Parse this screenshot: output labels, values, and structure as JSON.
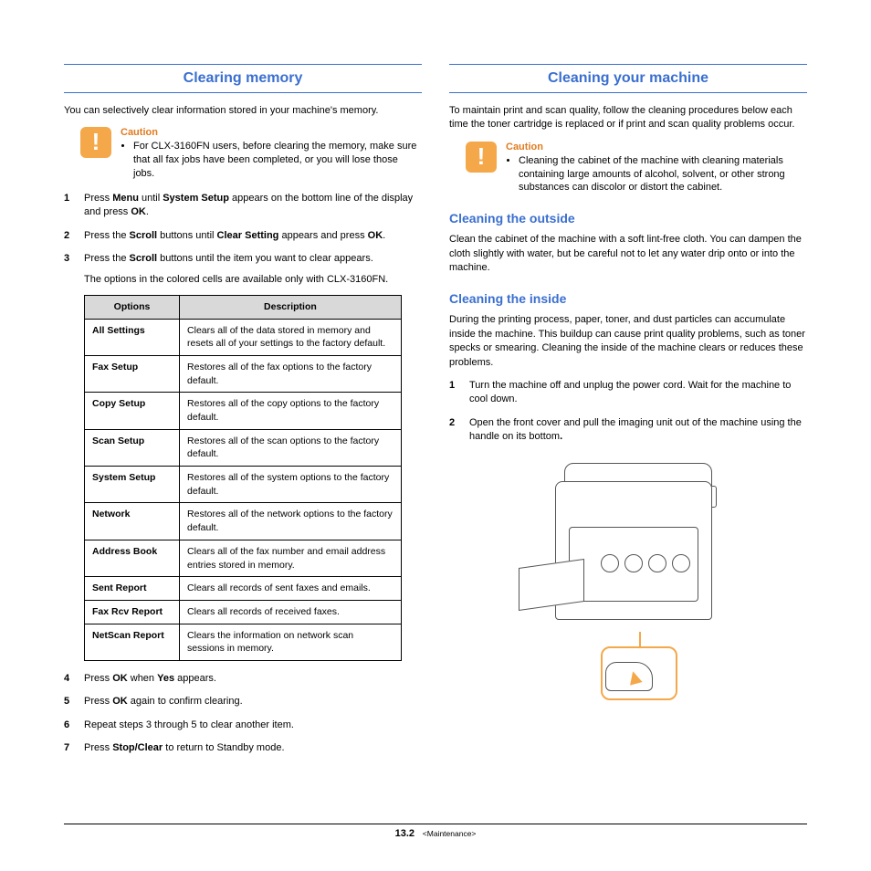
{
  "left": {
    "title": "Clearing memory",
    "intro": "You can selectively clear information stored in your machine's memory.",
    "caution": {
      "label": "Caution",
      "text": "For CLX-3160FN users, before clearing the memory, make sure that all fax jobs have been completed, or you will lose those jobs."
    },
    "step1_a": "Press ",
    "step1_b": "Menu",
    "step1_c": " until ",
    "step1_d": "System Setup",
    "step1_e": " appears on the bottom line of the display and press ",
    "step1_f": "OK",
    "step1_g": ".",
    "step2_a": "Press the ",
    "step2_b": "Scroll",
    "step2_c": " buttons until ",
    "step2_d": "Clear Setting",
    "step2_e": " appears and press ",
    "step2_f": "OK",
    "step2_g": ".",
    "step3_a": "Press the ",
    "step3_b": "Scroll",
    "step3_c": " buttons until the item you want to clear appears.",
    "note": "The options in the colored cells are available only with CLX-3160FN.",
    "table": {
      "h1": "Options",
      "h2": "Description",
      "rows": [
        {
          "o": "All Settings",
          "d": "Clears all of the data stored in memory and resets all of your settings to the factory default."
        },
        {
          "o": "Fax Setup",
          "d": "Restores all of the fax options to the factory default."
        },
        {
          "o": "Copy Setup",
          "d": "Restores all of the copy options to the factory default."
        },
        {
          "o": "Scan Setup",
          "d": "Restores all of the scan options to the factory default."
        },
        {
          "o": "System Setup",
          "d": "Restores all of the system options to the factory default."
        },
        {
          "o": "Network",
          "d": "Restores all of the network options to the factory default."
        },
        {
          "o": "Address Book",
          "d": "Clears all of the fax number and email address entries stored in memory."
        },
        {
          "o": "Sent Report",
          "d": "Clears all records of sent faxes and emails."
        },
        {
          "o": "Fax Rcv Report",
          "d": "Clears all records of received faxes."
        },
        {
          "o": "NetScan Report",
          "d": "Clears the information on network scan sessions in memory."
        }
      ]
    },
    "step4_a": "Press ",
    "step4_b": "OK",
    "step4_c": " when ",
    "step4_d": "Yes",
    "step4_e": " appears.",
    "step5_a": "Press ",
    "step5_b": "OK",
    "step5_c": " again to confirm clearing.",
    "step6": "Repeat steps 3 through 5 to clear another item.",
    "step7_a": "Press ",
    "step7_b": "Stop/Clear",
    "step7_c": " to return to Standby mode."
  },
  "right": {
    "title": "Cleaning your machine",
    "intro": "To maintain print and scan quality, follow the cleaning procedures below each time the toner cartridge is replaced or if print and scan quality problems occur.",
    "caution": {
      "label": "Caution",
      "text": "Cleaning the cabinet of the machine with cleaning materials containing large amounts of alcohol, solvent, or other strong substances can discolor or distort the cabinet."
    },
    "sub1": "Cleaning the outside",
    "p1": "Clean the cabinet of the machine with a soft lint-free cloth. You can dampen the cloth slightly with water, but be careful not to let any water drip onto or into the machine.",
    "sub2": "Cleaning the inside",
    "p2": "During the printing process, paper, toner, and dust particles can accumulate inside the machine. This buildup can cause print quality problems, such as toner specks or smearing. Cleaning the inside of the machine clears or reduces these problems.",
    "step1": "Turn the machine off and unplug the power cord. Wait for the machine to cool down.",
    "step2_a": "Open the front cover and pull the imaging unit out of the machine using the handle on its bottom",
    "step2_b": "."
  },
  "footer": {
    "chapter": "13",
    "page": ".2",
    "section": "<Maintenance>"
  }
}
